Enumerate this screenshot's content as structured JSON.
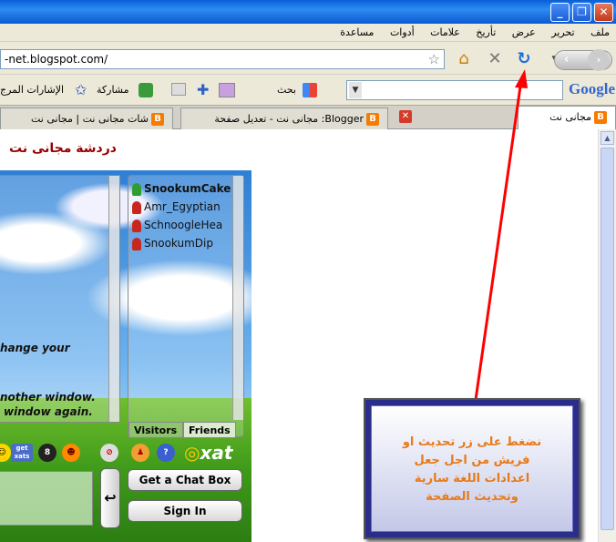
{
  "menubar": {
    "items": [
      "ملف",
      "تحرير",
      "عرض",
      "تأريخ",
      "علامات",
      "أدوات",
      "مساعدة"
    ]
  },
  "navbar": {
    "url": "-net.blogspot.com/"
  },
  "gbar": {
    "google_logo": "Google",
    "search_label": "بحث",
    "share_label": "مشاركة",
    "bookmarks_label": "الإشارات المرج"
  },
  "tabs": [
    {
      "label": "مجانى نت",
      "active": true
    },
    {
      "label": "Blogger: مجانى نت - تعديل صفحة",
      "active": false
    },
    {
      "label": "شات مجانى نت | مجانى نت",
      "active": false
    }
  ],
  "page": {
    "heading": "دردشة مجانى نت"
  },
  "chat": {
    "messages": [
      "hange your",
      "nother window.",
      "window again."
    ],
    "users": [
      "SnookumCake",
      "Amr_Egyptian",
      "SchnoogleHea",
      "SnookumDip"
    ],
    "tab_visitors": "Visitors",
    "tab_friends": "Friends",
    "get_xats": "get xats",
    "xat_logo": "xat",
    "get_chat_box": "Get a Chat Box",
    "sign_in": "Sign In"
  },
  "callout": {
    "lines": [
      "نضغط على زر تحديث او",
      "فريش من اجل جعل",
      "اعدادات اللغة سارية",
      "وتحديث الصفحة"
    ]
  },
  "colors": {
    "arrow": "#ff0000",
    "callout_text": "#e87a18",
    "heading": "#990000"
  }
}
